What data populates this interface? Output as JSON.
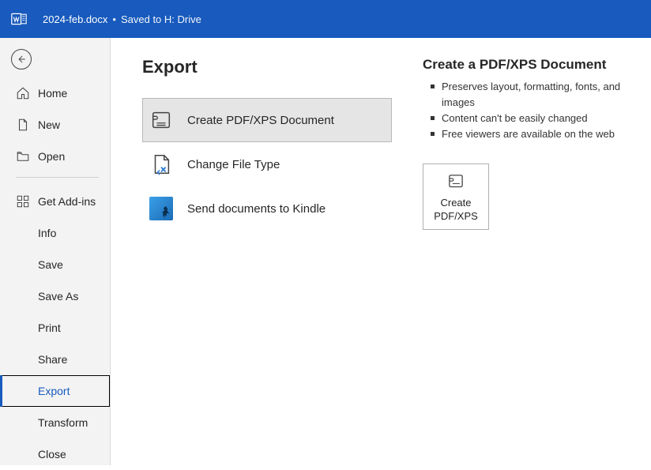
{
  "titlebar": {
    "doc_name": "2024-feb.docx",
    "saved_status": "Saved to H: Drive"
  },
  "sidebar": {
    "section1": [
      {
        "key": "home",
        "label": "Home"
      },
      {
        "key": "new",
        "label": "New"
      },
      {
        "key": "open",
        "label": "Open"
      }
    ],
    "section2": [
      {
        "key": "getaddins",
        "label": "Get Add-ins"
      },
      {
        "key": "info",
        "label": "Info"
      },
      {
        "key": "save",
        "label": "Save"
      },
      {
        "key": "saveas",
        "label": "Save As"
      },
      {
        "key": "print",
        "label": "Print"
      },
      {
        "key": "share",
        "label": "Share"
      },
      {
        "key": "export",
        "label": "Export",
        "selected": true
      },
      {
        "key": "transform",
        "label": "Transform"
      },
      {
        "key": "close",
        "label": "Close"
      }
    ]
  },
  "page": {
    "title": "Export",
    "options": [
      {
        "key": "pdfxps",
        "label": "Create PDF/XPS Document",
        "selected": true
      },
      {
        "key": "filetype",
        "label": "Change File Type"
      },
      {
        "key": "kindle",
        "label": "Send documents to Kindle"
      }
    ],
    "detail": {
      "title": "Create a PDF/XPS Document",
      "bullets": [
        "Preserves layout, formatting, fonts, and images",
        "Content can't be easily changed",
        "Free viewers are available on the web"
      ],
      "action": {
        "line1": "Create",
        "line2": "PDF/XPS"
      }
    }
  }
}
